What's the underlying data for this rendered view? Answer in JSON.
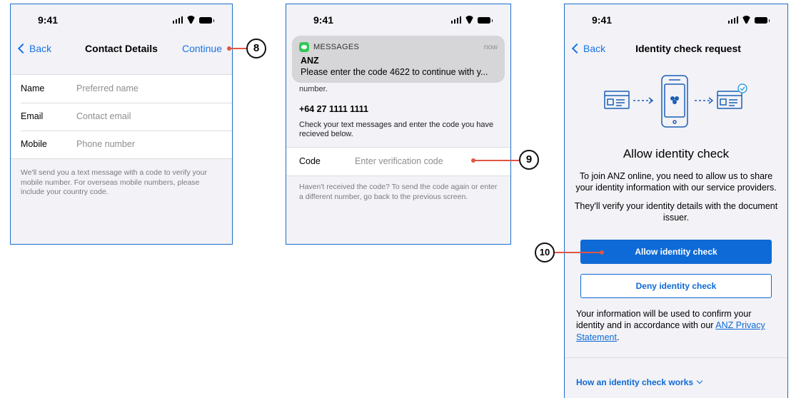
{
  "status_time": "9:41",
  "screen1": {
    "back": "Back",
    "title": "Contact Details",
    "action": "Continue",
    "fields": [
      {
        "label": "Name",
        "placeholder": "Preferred name"
      },
      {
        "label": "Email",
        "placeholder": "Contact email"
      },
      {
        "label": "Mobile",
        "placeholder": "Phone number"
      }
    ],
    "footnote": "We'll send you a text message with a code to verify your mobile number. For overseas mobile numbers, please include your country code."
  },
  "screen2": {
    "notification": {
      "app": "MESSAGES",
      "time": "now",
      "sender": "ANZ",
      "body": "Please enter the code 4622 to continue with y..."
    },
    "partial_text": "number.",
    "phone": "+64 27 1111 1111",
    "instructions": "Check your text messages and enter the code you have recieved below.",
    "code_label": "Code",
    "code_placeholder": "Enter verification code",
    "footnote": "Haven't received the code? To send the code again or enter a different number, go back to the previous screen."
  },
  "screen3": {
    "back": "Back",
    "title": "Identity check request",
    "heading": "Allow identity check",
    "para1": "To join ANZ online, you need to allow us to share your identity information with our service providers.",
    "para2": "They'll verify your identity details with the document issuer.",
    "allow_button": "Allow identity check",
    "deny_button": "Deny identity check",
    "info_text": "Your information will be used to confirm your identity and in accordance with our ",
    "info_link": "ANZ Privacy Statement",
    "info_end": ".",
    "how_link": "How an identity check works"
  },
  "callouts": [
    "8",
    "9",
    "10"
  ],
  "colors": {
    "accent": "#0e6ad6",
    "frame": "#1b6fc9",
    "callout_line": "#e05545",
    "message_green": "#34c759"
  }
}
